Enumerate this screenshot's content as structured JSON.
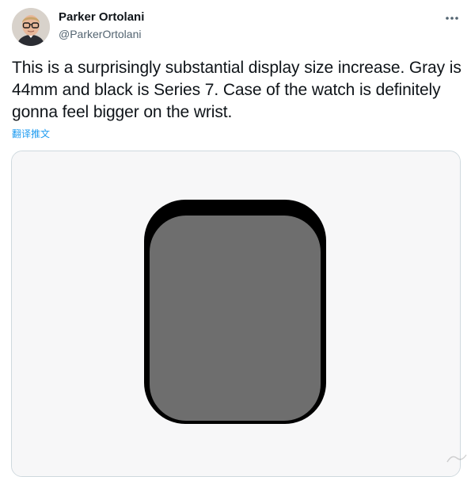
{
  "author": {
    "display_name": "Parker Ortolani",
    "handle": "@ParkerOrtolani",
    "avatar_icon": "person-with-glasses-avatar"
  },
  "tweet": {
    "text": "This is a surprisingly substantial display size increase. Gray is 44mm and black is Series 7. Case of the watch is definitely gonna feel bigger on the wrist.",
    "translate_label": "翻译推文"
  },
  "media": {
    "background_color": "#f7f7f8",
    "series7_display_color": "#000000",
    "mm44_display_color": "#6e6e6e"
  },
  "icons": {
    "more": "more-horizontal-icon"
  }
}
